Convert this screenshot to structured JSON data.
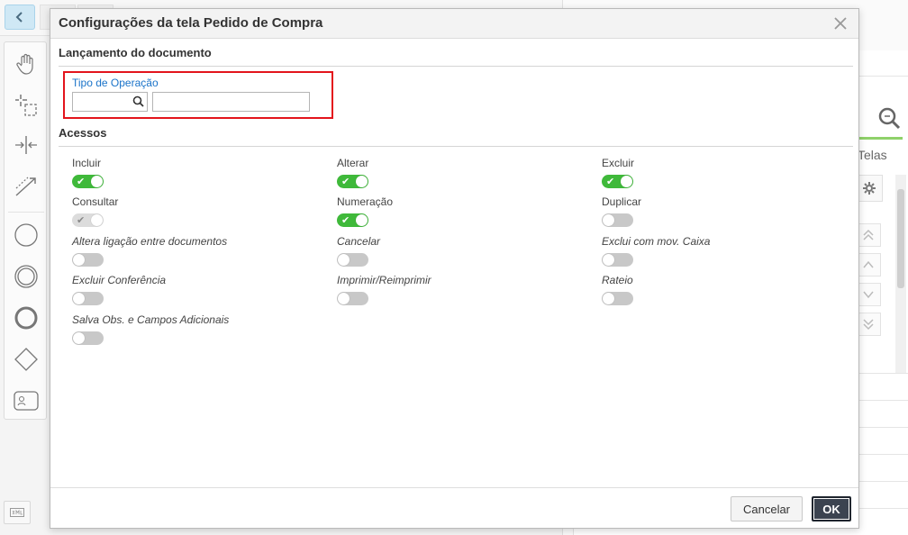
{
  "background": {
    "right_panel": {
      "tab_label": "Telas"
    }
  },
  "modal": {
    "title": "Configurações da tela Pedido de Compra",
    "sections": {
      "launch": {
        "title": "Lançamento do documento",
        "field_label": "Tipo de Operação",
        "code_value": "",
        "description_value": ""
      },
      "access": {
        "title": "Acessos",
        "permissions": [
          {
            "label": "Incluir",
            "state": "on",
            "italic": false
          },
          {
            "label": "Alterar",
            "state": "on",
            "italic": false
          },
          {
            "label": "Excluir",
            "state": "on",
            "italic": false
          },
          {
            "label": "Consultar",
            "state": "disabled",
            "italic": false
          },
          {
            "label": "Numeração",
            "state": "on",
            "italic": false
          },
          {
            "label": "Duplicar",
            "state": "off",
            "italic": false
          },
          {
            "label": "Altera ligação entre documentos",
            "state": "off",
            "italic": true
          },
          {
            "label": "Cancelar",
            "state": "off",
            "italic": true
          },
          {
            "label": "Exclui com mov. Caixa",
            "state": "off",
            "italic": true
          },
          {
            "label": "Excluir Conferência",
            "state": "off",
            "italic": true
          },
          {
            "label": "Imprimir/Reimprimir",
            "state": "off",
            "italic": true
          },
          {
            "label": "Rateio",
            "state": "off",
            "italic": true
          },
          {
            "label": "Salva Obs. e Campos Adicionais",
            "state": "off",
            "italic": true
          }
        ]
      }
    },
    "footer": {
      "cancel_label": "Cancelar",
      "ok_label": "OK"
    }
  },
  "colors": {
    "toggle_on": "#3fb93a",
    "toggle_off": "#c8c8c8",
    "highlight": "#e3141c",
    "link_label": "#1a73c9"
  },
  "icons": [
    "back-icon",
    "hand-icon",
    "select-icon",
    "split-icon",
    "connector-icon",
    "circle-icon",
    "double-circle-icon",
    "thick-circle-icon",
    "diamond-icon",
    "task-icon",
    "search-icon",
    "gear-icon",
    "close-icon"
  ]
}
